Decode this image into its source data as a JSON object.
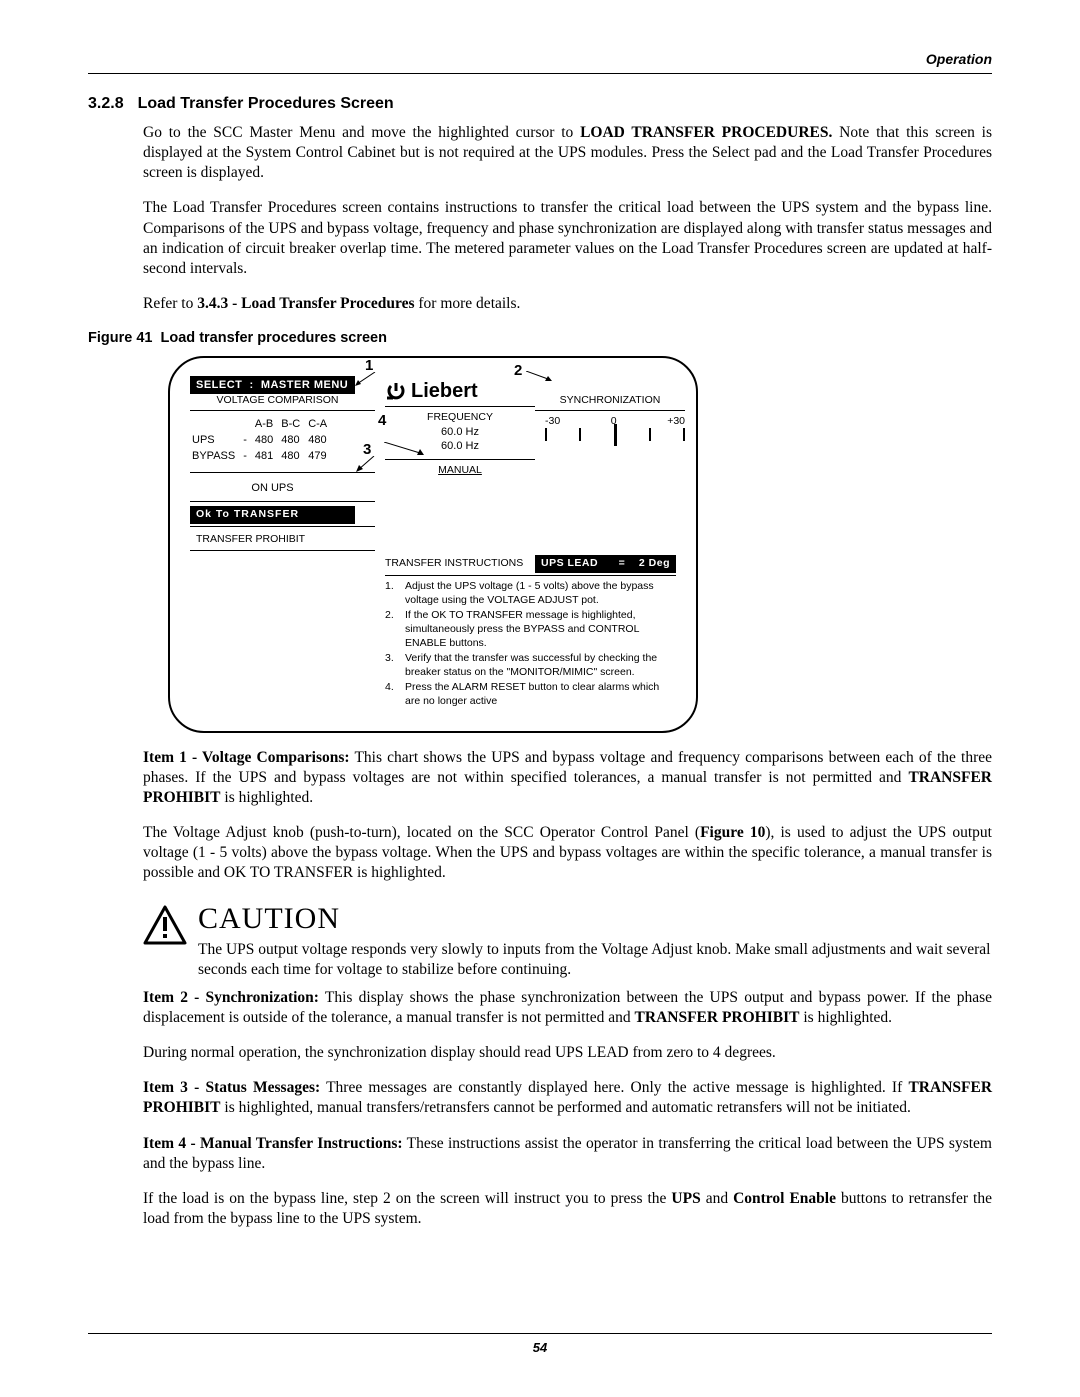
{
  "header": {
    "running": "Operation"
  },
  "section": {
    "number": "3.2.8",
    "title": "Load Transfer Procedures Screen"
  },
  "body": {
    "p1": {
      "bold1": "LOAD TRANSFER PROCEDURES."
    },
    "p2": "The Load Transfer Procedures screen contains instructions to transfer the critical load between the UPS system and the bypass line. Comparisons of the UPS and bypass voltage, frequency and phase synchronization are displayed along with transfer status messages and an indication of circuit breaker overlap time. The metered parameter values on the Load Transfer Procedures screen are updated at half-second intervals.",
    "p3": {
      "bold1": "3.4.3 - Load Transfer Procedures"
    }
  },
  "figure": {
    "label": "Figure 41",
    "title": "Load transfer procedures screen",
    "callouts": [
      "1",
      "2",
      "3",
      "4"
    ]
  },
  "screen": {
    "select_master": [
      "SELECT",
      "MASTER MENU"
    ],
    "voltage_comparison_label": "VOLTAGE COMPARISON",
    "vtable": {
      "cols": [
        "A-B",
        "B-C",
        "C-A"
      ],
      "rows": [
        {
          "label": "UPS",
          "vals": [
            "480",
            "480",
            "480"
          ]
        },
        {
          "label": "BYPASS",
          "vals": [
            "481",
            "480",
            "479"
          ]
        }
      ]
    },
    "status": [
      "ON UPS",
      "Ok  To  TRANSFER",
      "TRANSFER PROHIBIT"
    ],
    "brand": "Liebert",
    "frequency": {
      "label": "FREQUENCY",
      "vals": [
        "60.0 Hz",
        "60.0 Hz"
      ]
    },
    "manual_label": "MANUAL",
    "sync": {
      "label": "SYNCHRONIZATION",
      "scale": [
        "-30",
        "0",
        "+30"
      ]
    },
    "transfer_instructions_label": "TRANSFER INSTRUCTIONS",
    "ups_lead": {
      "label": "UPS  LEAD",
      "eq": "=",
      "value": "2 Deg"
    },
    "instructions": [
      {
        "n": "1.",
        "t": "Adjust the UPS voltage (1 - 5 volts) above the bypass voltage using the VOLTAGE ADJUST pot."
      },
      {
        "n": "2.",
        "t": "If the OK TO TRANSFER message is highlighted, simultaneously press the BYPASS  and CONTROL ENABLE buttons."
      },
      {
        "n": "3.",
        "t": "Verify that the transfer was successful by checking the breaker status on the \"MONITOR/MIMIC\" screen."
      },
      {
        "n": "4.",
        "t": "Press the ALARM RESET button to clear alarms which are no longer active"
      }
    ]
  },
  "items": {
    "i1": {
      "label": "Item 1 - Voltage Comparisons:",
      "p1a": "This chart shows the UPS and bypass voltage and frequency comparisons between each of the three phases. If the UPS and bypass voltages are not within specified tolerances, a manual transfer is not permitted and",
      "bold": "TRANSFER PROHIBIT",
      "p1b": "is highlighted.",
      "figref": "Figure 10"
    },
    "i2": {
      "label": "Item 2 - Synchronization:",
      "p1a": "This display shows the phase synchronization between the UPS output and bypass power. If the phase displacement is outside of the tolerance, a manual transfer is not permitted and",
      "bold": "TRANSFER PROHIBIT",
      "p1b": "is highlighted.",
      "p2": "During normal operation, the synchronization display should read UPS LEAD from zero to 4 degrees."
    },
    "i3": {
      "label": "Item 3 - Status Messages:",
      "p1a": "Three messages are constantly displayed here. Only the active message is highlighted. If",
      "bold": "TRANSFER PROHIBIT",
      "p1b": "is highlighted, manual transfers/retransfers cannot be performed and automatic retransfers will not be initiated."
    },
    "i4": {
      "label": "Item 4 - Manual Transfer Instructions:",
      "p1": "These instructions assist the operator in transferring the critical load between the UPS system and the bypass line.",
      "b1": "UPS",
      "b2": "Control Enable"
    }
  },
  "caution": {
    "title": "CAUTION",
    "text": "The UPS output voltage responds very slowly to inputs from the Voltage Adjust knob. Make small adjustments and wait several seconds each time for voltage to stabilize before continuing."
  },
  "footer": {
    "page": "54"
  }
}
